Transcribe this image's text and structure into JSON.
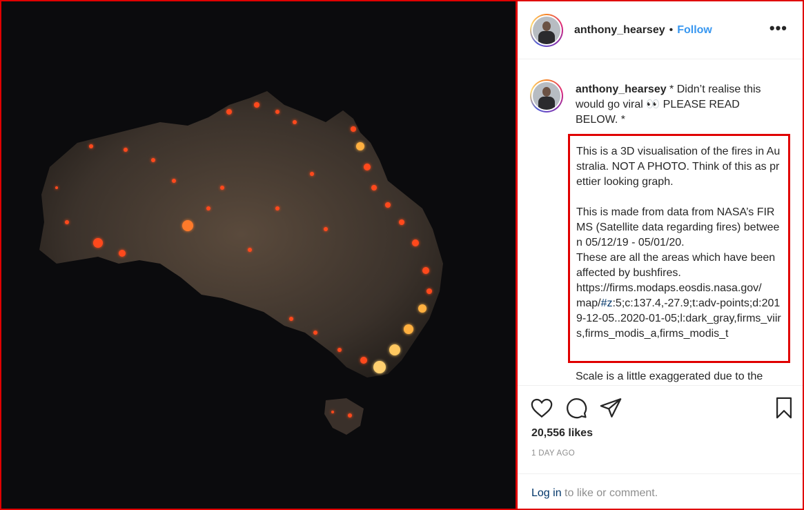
{
  "post": {
    "username": "anthony_hearsey",
    "separator": "•",
    "follow_label": "Follow",
    "more_label": "•••"
  },
  "caption": {
    "username": "anthony_hearsey",
    "intro": " * Didn’t realise this would go viral 👀 PLEASE READ BELOW. *",
    "para1": "This is a 3D visualisation of the fires in Australia. NOT A PHOTO. Think of this as prettier looking graph.",
    "para2_a": "This is made from data from NASA’s FIRMS (Satellite data regarding fires) between 05/12/19 - 05/01/20.\nThese are all the areas which have been affected by bushfires.\nhttps://firms.modaps.eosdis.nasa.gov/\nmap/",
    "hashtag": "#z",
    "para2_b": ":5;c:137.4,-27.9;t:adv-points;d:2019-12-05..2020-01-05;l:dark_gray,firms_viirs,firms_modis_a,firms_modis_t",
    "continuation": "Scale is a little exaggerated due to the"
  },
  "stats": {
    "likes": "20,556 likes",
    "time_ago": "1 DAY AGO"
  },
  "login": {
    "link_text": "Log in",
    "rest_text": " to like or comment."
  },
  "icons": {
    "like": "heart-icon",
    "comment": "comment-icon",
    "share": "share-icon",
    "save": "bookmark-icon",
    "more": "more-options-icon"
  },
  "colors": {
    "follow": "#3897f0",
    "link": "#003569",
    "muted": "#8e8e8e",
    "highlight_border": "#e00000",
    "fire": "#ff4a1c"
  }
}
